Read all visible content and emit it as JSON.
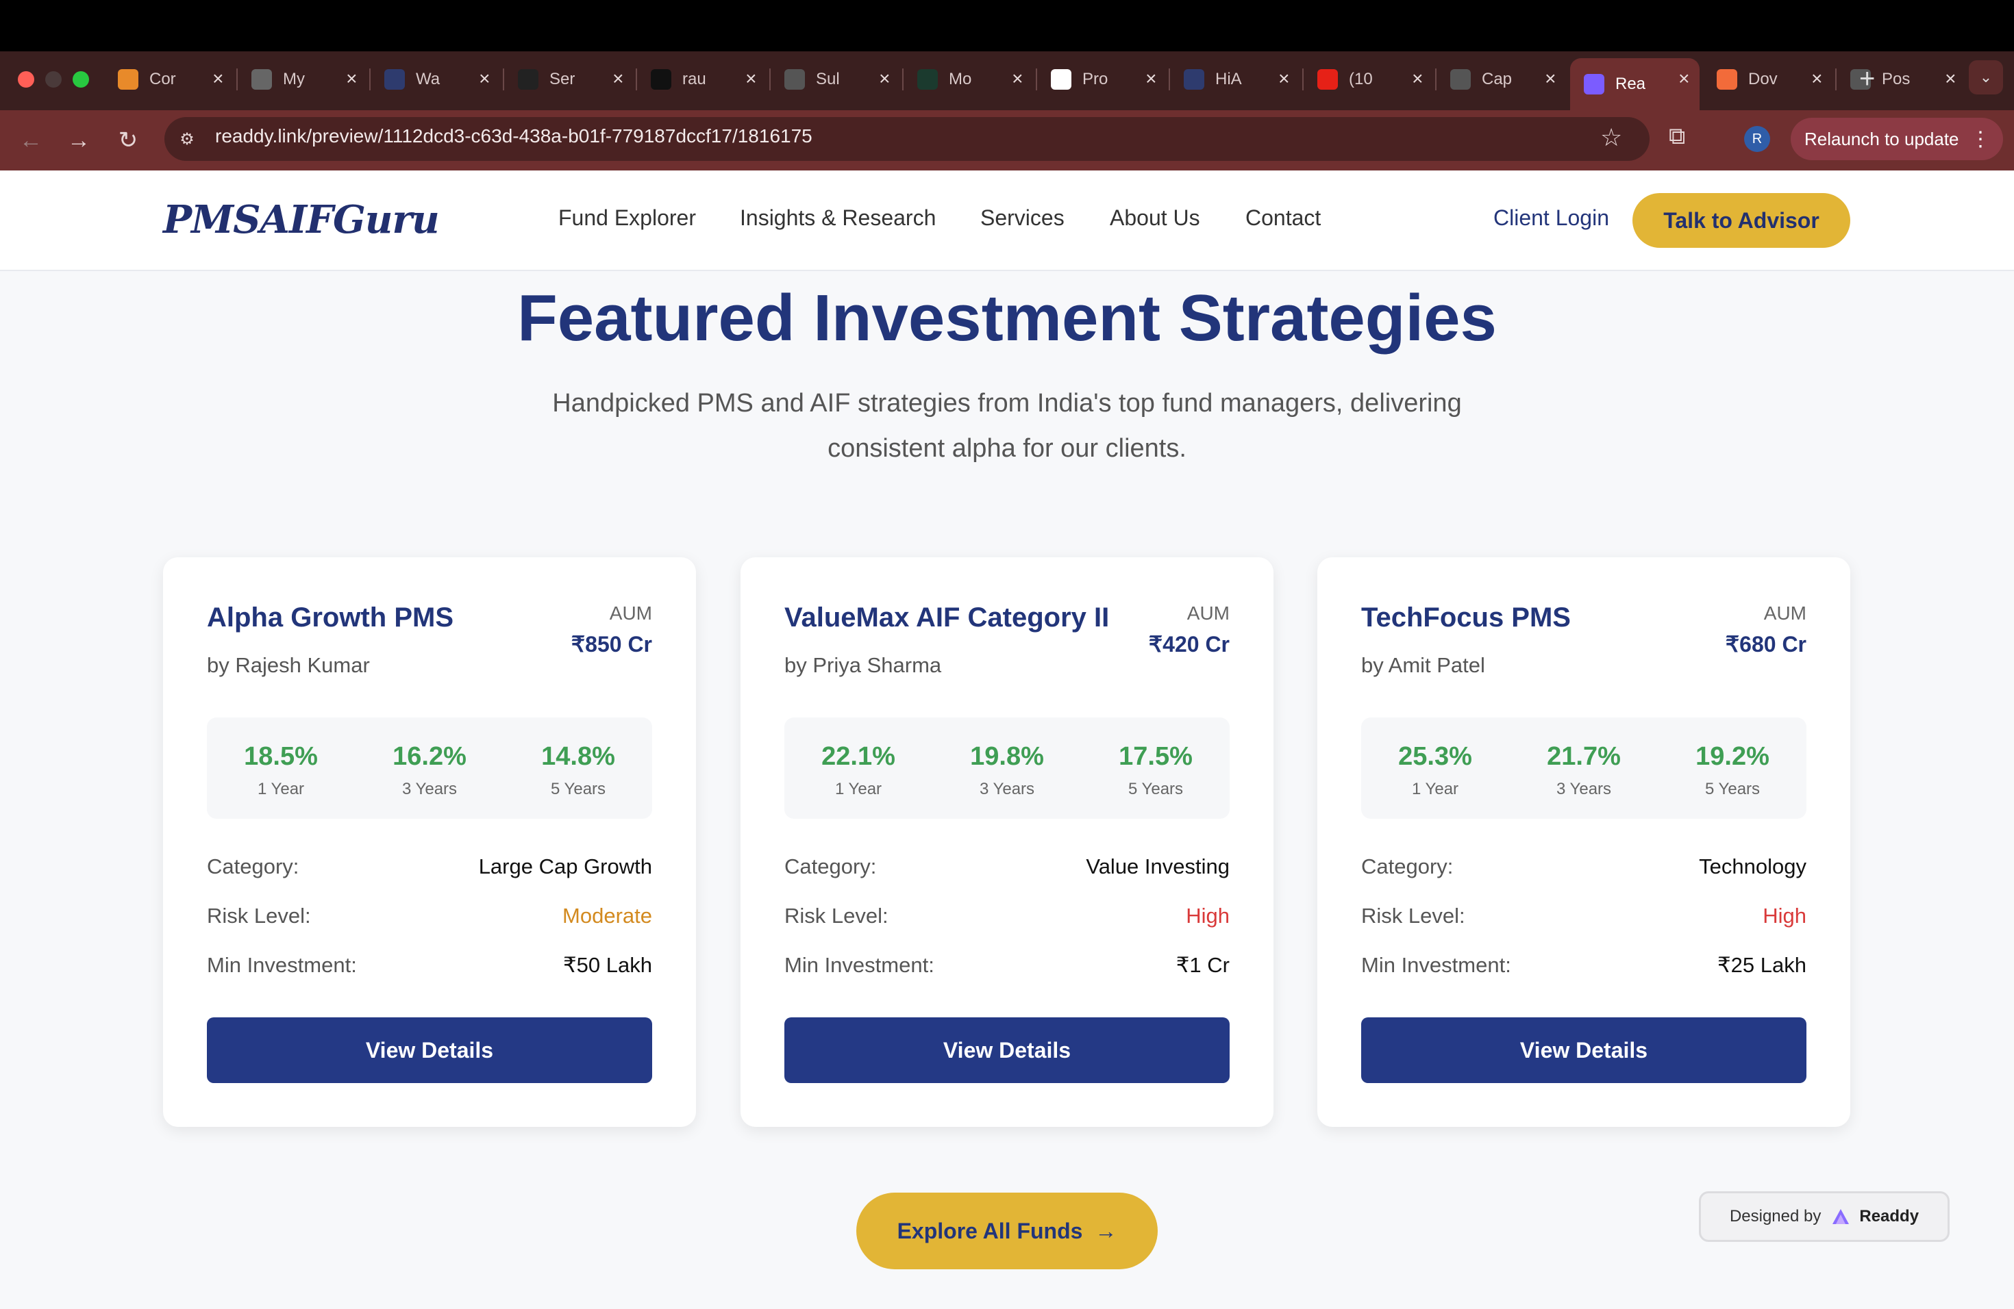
{
  "browser": {
    "tabs": [
      {
        "title": "Cor",
        "favicon": "box-icon",
        "color": "#e88a2a"
      },
      {
        "title": "My",
        "favicon": "chrome-icon",
        "color": "#666666"
      },
      {
        "title": "Wa",
        "favicon": "h-icon",
        "color": "#2e3b6e"
      },
      {
        "title": "Ser",
        "favicon": "openai-icon",
        "color": "#222222"
      },
      {
        "title": "rau",
        "favicon": "github-icon",
        "color": "#111111"
      },
      {
        "title": "Sul",
        "favicon": "globe-icon",
        "color": "#555555"
      },
      {
        "title": "Mo",
        "favicon": "mt-icon",
        "color": "#1b3a2e"
      },
      {
        "title": "Pro",
        "favicon": "vo-icon",
        "color": "#ffffff"
      },
      {
        "title": "HiA",
        "favicon": "h-icon",
        "color": "#2e3b6e"
      },
      {
        "title": "(10",
        "favicon": "youtube-icon",
        "color": "#e62117"
      },
      {
        "title": "Cap",
        "favicon": "globe-icon",
        "color": "#555555"
      },
      {
        "title": "Rea",
        "favicon": "readdy-icon",
        "color": "#7b5cff",
        "active": true
      },
      {
        "title": "Dov",
        "favicon": "dovetail-icon",
        "color": "#f26b3a"
      },
      {
        "title": "Pos",
        "favicon": "globe-icon",
        "color": "#555555"
      }
    ],
    "url": "readdy.link/preview/1112dcd3-c63d-438a-b01f-779187dccf17/1816175",
    "profile_initial": "R",
    "relaunch_label": "Relaunch to update"
  },
  "header": {
    "logo": "PMSAIFGuru",
    "nav": [
      "Fund Explorer",
      "Insights & Research",
      "Services",
      "About Us",
      "Contact"
    ],
    "login_label": "Client Login",
    "advisor_label": "Talk to Advisor"
  },
  "section": {
    "title": "Featured Investment Strategies",
    "subtitle_line1": "Handpicked PMS and AIF strategies from India's top fund managers, delivering",
    "subtitle_line2": "consistent alpha for our clients."
  },
  "cards": [
    {
      "name": "Alpha Growth PMS",
      "manager": "by Rajesh Kumar",
      "aum_label": "AUM",
      "aum": "₹850 Cr",
      "returns": [
        {
          "value": "18.5%",
          "label": "1 Year"
        },
        {
          "value": "16.2%",
          "label": "3 Years"
        },
        {
          "value": "14.8%",
          "label": "5 Years"
        }
      ],
      "category_label": "Category:",
      "category": "Large Cap Growth",
      "risk_label": "Risk Level:",
      "risk": "Moderate",
      "risk_color": "#d38a1f",
      "min_label": "Min Investment:",
      "min": "₹50 Lakh",
      "button": "View Details"
    },
    {
      "name": "ValueMax AIF Category II",
      "manager": "by Priya Sharma",
      "aum_label": "AUM",
      "aum": "₹420 Cr",
      "returns": [
        {
          "value": "22.1%",
          "label": "1 Year"
        },
        {
          "value": "19.8%",
          "label": "3 Years"
        },
        {
          "value": "17.5%",
          "label": "5 Years"
        }
      ],
      "category_label": "Category:",
      "category": "Value Investing",
      "risk_label": "Risk Level:",
      "risk": "High",
      "risk_color": "#d93a3a",
      "min_label": "Min Investment:",
      "min": "₹1 Cr",
      "button": "View Details"
    },
    {
      "name": "TechFocus PMS",
      "manager": "by Amit Patel",
      "aum_label": "AUM",
      "aum": "₹680 Cr",
      "returns": [
        {
          "value": "25.3%",
          "label": "1 Year"
        },
        {
          "value": "21.7%",
          "label": "3 Years"
        },
        {
          "value": "19.2%",
          "label": "5 Years"
        }
      ],
      "category_label": "Category:",
      "category": "Technology",
      "risk_label": "Risk Level:",
      "risk": "High",
      "risk_color": "#d93a3a",
      "min_label": "Min Investment:",
      "min": "₹25 Lakh",
      "button": "View Details"
    }
  ],
  "explore_label": "Explore All Funds",
  "badge": {
    "prefix": "Designed by",
    "brand": "Readdy"
  },
  "colors": {
    "accent": "#e2b536",
    "primary": "#243985",
    "positive": "#3f9e54"
  }
}
